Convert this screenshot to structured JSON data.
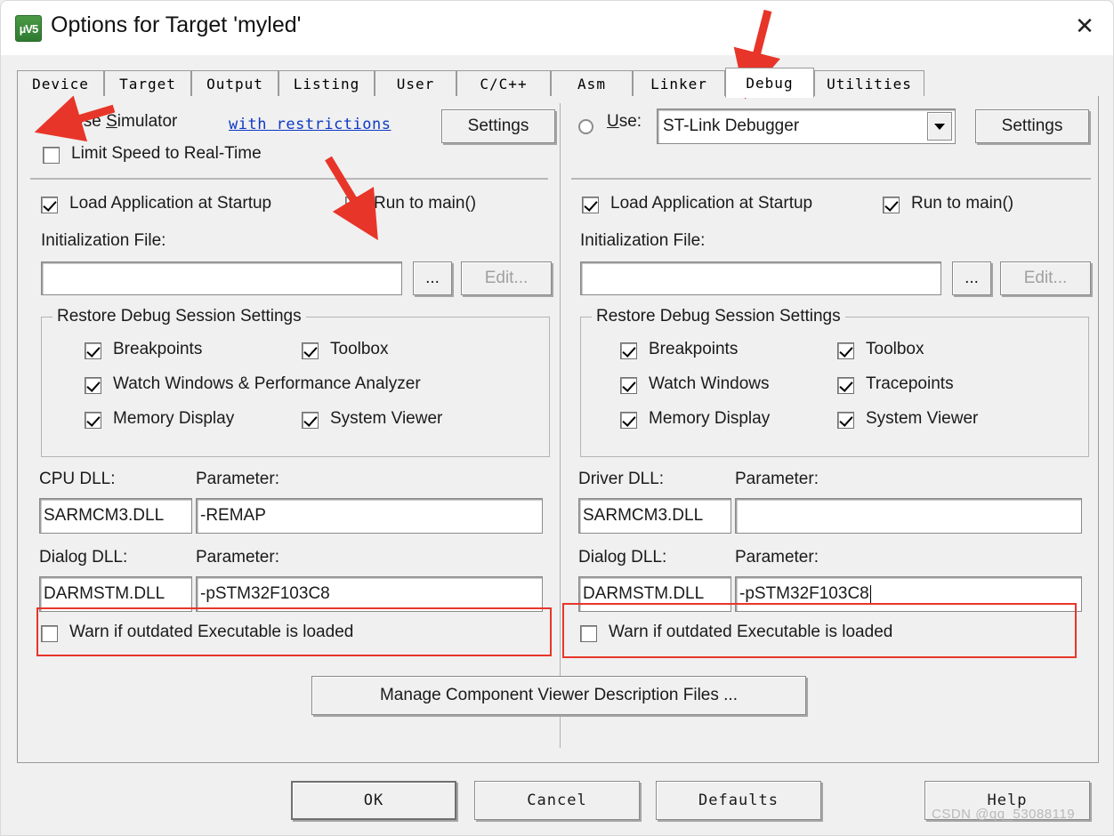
{
  "window": {
    "title": "Options for Target 'myled'",
    "app_icon": "keil-uvision5-icon",
    "close_label": "✕"
  },
  "tabs": [
    {
      "label": "Device",
      "selected": false
    },
    {
      "label": "Target",
      "selected": false
    },
    {
      "label": "Output",
      "selected": false
    },
    {
      "label": "Listing",
      "selected": false
    },
    {
      "label": "User",
      "selected": false
    },
    {
      "label": "C/C++",
      "selected": false
    },
    {
      "label": "Asm",
      "selected": false
    },
    {
      "label": "Linker",
      "selected": false
    },
    {
      "label": "Debug",
      "selected": true
    },
    {
      "label": "Utilities",
      "selected": false
    }
  ],
  "simulator_panel": {
    "use_simulator_label": "Use Simulator",
    "use_simulator_checked": true,
    "with_restrictions_link": "with restrictions",
    "settings_label": "Settings",
    "limit_speed_label": "Limit Speed to Real-Time",
    "limit_speed_checked": false,
    "load_app_label": "Load Application at Startup",
    "load_app_checked": true,
    "run_to_main_label": "Run to main()",
    "run_to_main_checked": true,
    "init_file_label": "Initialization File:",
    "init_file_value": "",
    "browse_label": "...",
    "edit_label": "Edit...",
    "restore_group_title": "Restore Debug Session Settings",
    "restore_items": [
      {
        "label": "Breakpoints",
        "checked": true
      },
      {
        "label": "Toolbox",
        "checked": true
      },
      {
        "label": "Watch Windows & Performance Analyzer",
        "checked": true
      },
      {
        "label": "Memory Display",
        "checked": true
      },
      {
        "label": "System Viewer",
        "checked": true
      }
    ],
    "cpu_dll_label": "CPU DLL:",
    "cpu_dll_value": "SARMCM3.DLL",
    "cpu_param_label": "Parameter:",
    "cpu_param_value": "-REMAP",
    "dialog_dll_label": "Dialog DLL:",
    "dialog_dll_value": "DARMSTM.DLL",
    "dialog_param_label": "Parameter:",
    "dialog_param_value": "-pSTM32F103C8",
    "warn_outdated_label": "Warn if outdated Executable is loaded",
    "warn_outdated_checked": false
  },
  "debugger_panel": {
    "use_label": "Use:",
    "use_checked": false,
    "debugger_selected": "ST-Link Debugger",
    "settings_label": "Settings",
    "load_app_label": "Load Application at Startup",
    "load_app_checked": true,
    "run_to_main_label": "Run to main()",
    "run_to_main_checked": true,
    "init_file_label": "Initialization File:",
    "init_file_value": "",
    "browse_label": "...",
    "edit_label": "Edit...",
    "restore_group_title": "Restore Debug Session Settings",
    "restore_items": [
      {
        "label": "Breakpoints",
        "checked": true
      },
      {
        "label": "Toolbox",
        "checked": true
      },
      {
        "label": "Watch Windows",
        "checked": true
      },
      {
        "label": "Tracepoints",
        "checked": true
      },
      {
        "label": "Memory Display",
        "checked": true
      },
      {
        "label": "System Viewer",
        "checked": true
      }
    ],
    "driver_dll_label": "Driver DLL:",
    "driver_dll_value": "SARMCM3.DLL",
    "driver_param_label": "Parameter:",
    "driver_param_value": "",
    "dialog_dll_label": "Dialog DLL:",
    "dialog_dll_value": "DARMSTM.DLL",
    "dialog_param_label": "Parameter:",
    "dialog_param_value": "-pSTM32F103C8",
    "warn_outdated_label": "Warn if outdated Executable is loaded",
    "warn_outdated_checked": false
  },
  "manage_button_label": "Manage Component Viewer Description Files ...",
  "footer": {
    "ok_label": "OK",
    "cancel_label": "Cancel",
    "defaults_label": "Defaults",
    "help_label": "Help"
  },
  "watermark": "CSDN @qq_53088119",
  "colors": {
    "annotation_red": "#e8352a",
    "link_blue": "#0d38c4",
    "dialog_face": "#f0f0f0"
  }
}
